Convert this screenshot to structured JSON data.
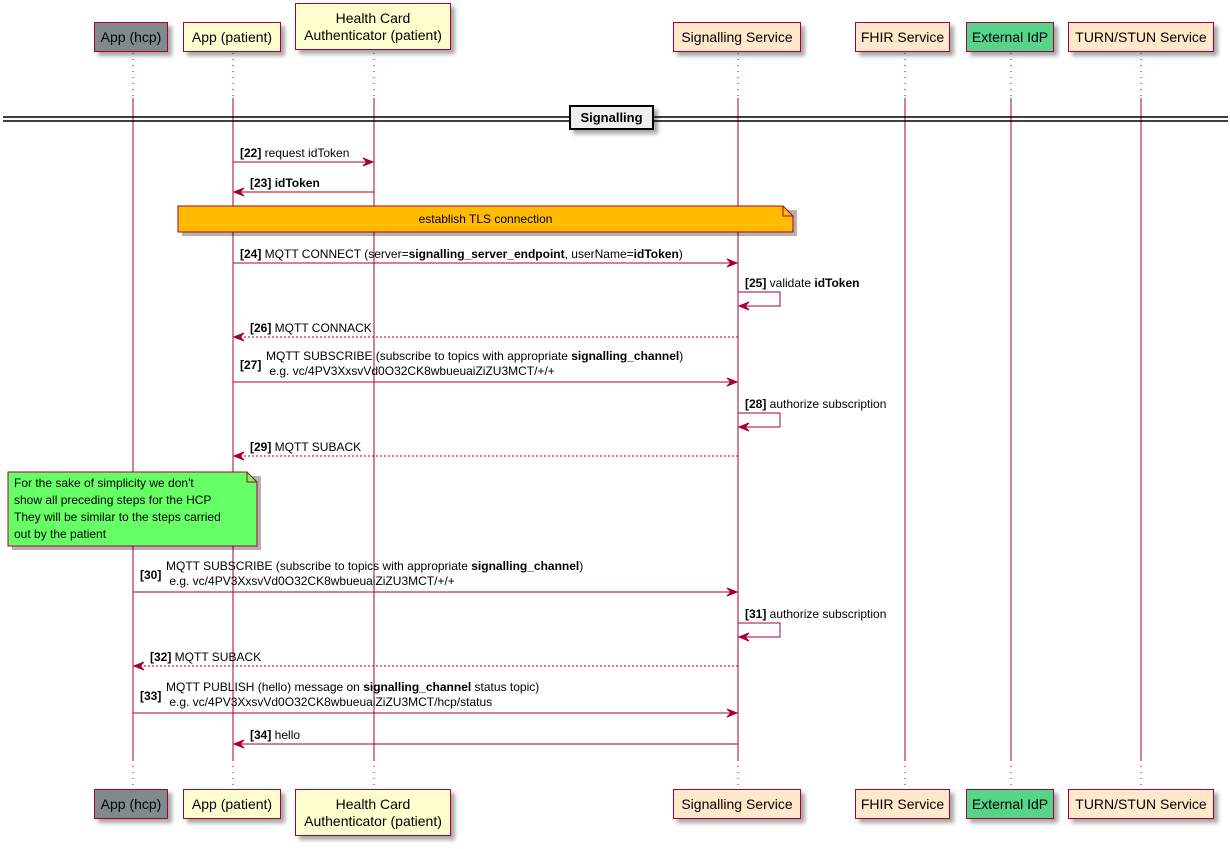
{
  "colors": {
    "line": "#A80036",
    "participant_default": "#FEFECE",
    "participant_service": "#FFE8CC",
    "participant_hcp": "#7F8B8B",
    "participant_idp": "#55D48A",
    "note_tls": "#FFBB00",
    "note_hcp": "#66FF66"
  },
  "participants": [
    {
      "id": "hcp",
      "label": "App (hcp)",
      "fill": "#7F8B8B"
    },
    {
      "id": "patient",
      "label": "App (patient)",
      "fill": "#FEFECE"
    },
    {
      "id": "hca",
      "label": "Health Card\nAuthenticator (patient)",
      "fill": "#FEFECE"
    },
    {
      "id": "sig",
      "label": "Signalling Service",
      "fill": "#FFE8CC"
    },
    {
      "id": "fhir",
      "label": "FHIR Service",
      "fill": "#FFE8CC"
    },
    {
      "id": "idp",
      "label": "External IdP",
      "fill": "#55D48A"
    },
    {
      "id": "turn",
      "label": "TURN/STUN Service",
      "fill": "#FFE8CC"
    }
  ],
  "divider": {
    "label": "Signalling"
  },
  "notes": [
    {
      "id": "tls",
      "text": "establish TLS connection"
    },
    {
      "id": "hcp_note",
      "lines": [
        "For the sake of simplicity we don't",
        "show all preceding steps for the HCP",
        "They will be similar to the steps carried",
        "out by the patient"
      ]
    }
  ],
  "messages": [
    {
      "num": "[22]",
      "from": "patient",
      "to": "hca",
      "style": "solid",
      "parts": [
        {
          "t": "request idToken",
          "b": false
        }
      ]
    },
    {
      "num": "[23]",
      "from": "hca",
      "to": "patient",
      "style": "solid",
      "parts": [
        {
          "t": "idToken",
          "b": true
        }
      ]
    },
    {
      "num": "[24]",
      "from": "patient",
      "to": "sig",
      "style": "solid",
      "parts": [
        {
          "t": "MQTT CONNECT (server=",
          "b": false
        },
        {
          "t": "signalling_server_endpoint",
          "b": true
        },
        {
          "t": ", userName=",
          "b": false
        },
        {
          "t": "idToken",
          "b": true
        },
        {
          "t": ")",
          "b": false
        }
      ]
    },
    {
      "num": "[25]",
      "from": "sig",
      "to": "sig",
      "style": "self",
      "parts": [
        {
          "t": "validate ",
          "b": false
        },
        {
          "t": "idToken",
          "b": true
        }
      ]
    },
    {
      "num": "[26]",
      "from": "sig",
      "to": "patient",
      "style": "dashed",
      "parts": [
        {
          "t": "MQTT CONNACK",
          "b": false
        }
      ]
    },
    {
      "num": "[27]",
      "from": "patient",
      "to": "sig",
      "style": "solid",
      "parts": [
        {
          "t": "MQTT SUBSCRIBE (subscribe to topics with appropriate ",
          "b": false
        },
        {
          "t": "signalling_channel",
          "b": true
        },
        {
          "t": ")",
          "b": false
        }
      ],
      "line2": " e.g. vc/4PV3XxsvVd0O32CK8wbueuaiZiZU3MCT/+/+"
    },
    {
      "num": "[28]",
      "from": "sig",
      "to": "sig",
      "style": "self",
      "parts": [
        {
          "t": "authorize subscription",
          "b": false
        }
      ]
    },
    {
      "num": "[29]",
      "from": "sig",
      "to": "patient",
      "style": "dashed",
      "parts": [
        {
          "t": "MQTT SUBACK",
          "b": false
        }
      ]
    },
    {
      "num": "[30]",
      "from": "hcp",
      "to": "sig",
      "style": "solid",
      "parts": [
        {
          "t": "MQTT SUBSCRIBE (subscribe to topics with appropriate ",
          "b": false
        },
        {
          "t": "signalling_channel",
          "b": true
        },
        {
          "t": ")",
          "b": false
        }
      ],
      "line2": " e.g. vc/4PV3XxsvVd0O32CK8wbueuaiZiZU3MCT/+/+"
    },
    {
      "num": "[31]",
      "from": "sig",
      "to": "sig",
      "style": "self",
      "parts": [
        {
          "t": "authorize subscription",
          "b": false
        }
      ]
    },
    {
      "num": "[32]",
      "from": "sig",
      "to": "hcp",
      "style": "dashed",
      "parts": [
        {
          "t": "MQTT SUBACK",
          "b": false
        }
      ]
    },
    {
      "num": "[33]",
      "from": "hcp",
      "to": "sig",
      "style": "solid",
      "parts": [
        {
          "t": "MQTT PUBLISH (hello) message on ",
          "b": false
        },
        {
          "t": "signalling_channel",
          "b": true
        },
        {
          "t": " status topic)",
          "b": false
        }
      ],
      "line2": " e.g. vc/4PV3XxsvVd0O32CK8wbueuaiZiZU3MCT/hcp/status"
    },
    {
      "num": "[34]",
      "from": "sig",
      "to": "patient",
      "style": "solid",
      "parts": [
        {
          "t": "hello",
          "b": false
        }
      ]
    }
  ]
}
